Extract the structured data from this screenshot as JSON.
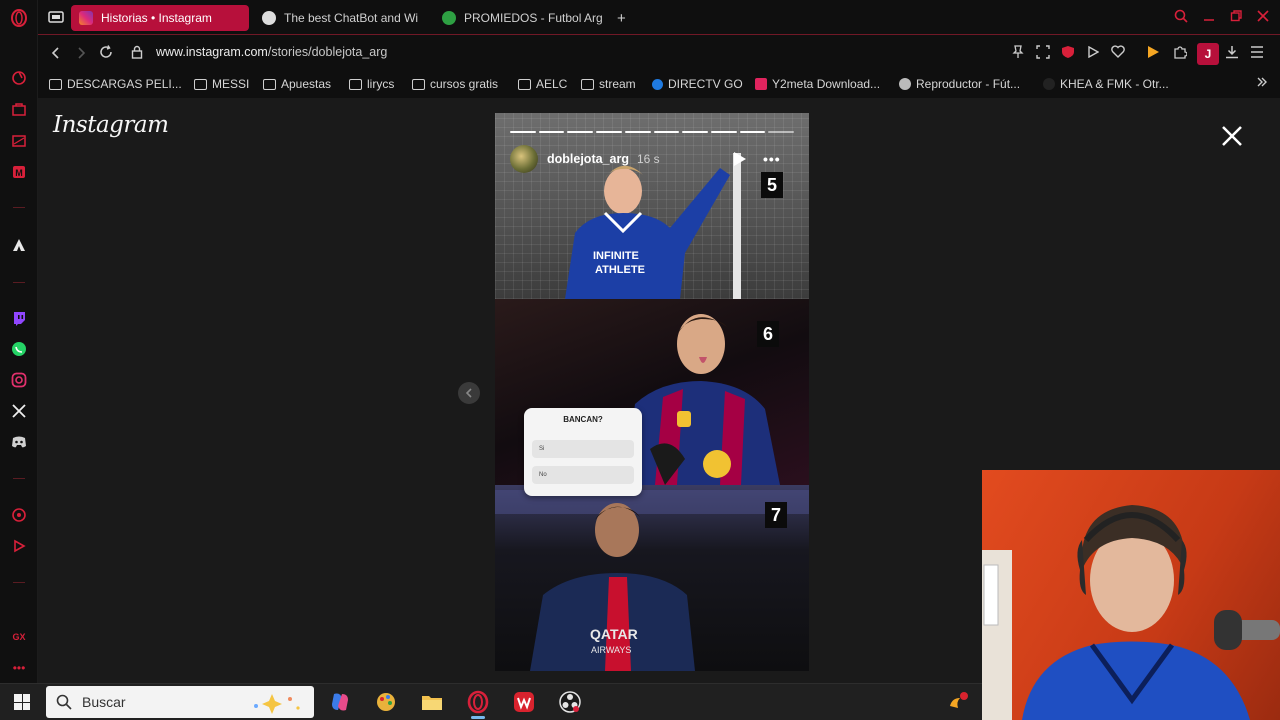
{
  "colors": {
    "accent": "#b7103b",
    "opera_red": "#d8203a",
    "page_bg": "#1a1a1a",
    "taskbar_bg": "#202020"
  },
  "sidebar": {
    "icons": [
      "opera-logo-icon",
      "aria-icon",
      "workspaces-icon",
      "wallet-icon",
      "messenger-icon",
      "vk-icon",
      "twitch-icon",
      "whatsapp-icon",
      "instagram-icon",
      "x-icon",
      "discord-icon",
      "player-icon",
      "music-icon",
      "gx-label",
      "more-icon"
    ],
    "gx_label": "GX"
  },
  "tabs": [
    {
      "title": "Historias • Instagram",
      "active": true,
      "favicon_color": "#e1306c",
      "favicon": "instagram-favicon-icon"
    },
    {
      "title": "The best ChatBot and Wi",
      "active": false,
      "favicon_color": "#dddddd",
      "favicon": "chatbot-favicon-icon"
    },
    {
      "title": "PROMIEDOS - Futbol Arg",
      "active": false,
      "favicon_color": "#2ea043",
      "favicon": "promiedos-favicon-icon"
    }
  ],
  "new_tab_label": "+",
  "address": {
    "host": "www.instagram.com",
    "path": "/stories/doblejota_arg"
  },
  "profile_initial": "J",
  "bookmarks": [
    {
      "label": "DESCARGAS PELI...",
      "type": "folder"
    },
    {
      "label": "MESSI",
      "type": "folder"
    },
    {
      "label": "Apuestas",
      "type": "folder"
    },
    {
      "label": "lirycs",
      "type": "folder"
    },
    {
      "label": "cursos gratis",
      "type": "folder"
    },
    {
      "label": "AELC",
      "type": "folder"
    },
    {
      "label": "stream",
      "type": "folder"
    },
    {
      "label": "DIRECTV GO",
      "type": "site",
      "color": "#1f7ae0"
    },
    {
      "label": "Y2meta Download...",
      "type": "site",
      "color": "#e0245e"
    },
    {
      "label": "Reproductor - Fút...",
      "type": "site",
      "color": "#bbbbbb"
    },
    {
      "label": "KHEA & FMK - Otr...",
      "type": "site",
      "color": "#222222"
    }
  ],
  "page": {
    "logo": "Instagram",
    "story": {
      "username": "doblejota_arg",
      "time": "16 s",
      "segments_total": 10,
      "segments_done": 9,
      "more_label": "•••",
      "badges": [
        "5",
        "6",
        "7"
      ],
      "poll": {
        "question": "BANCAN?",
        "options": [
          "Si",
          "No"
        ]
      }
    }
  },
  "taskbar": {
    "search_placeholder": "Buscar",
    "apps": [
      {
        "name": "copilot-icon",
        "color": "#3b7be8"
      },
      {
        "name": "paint-icon",
        "color": "#e9b23b"
      },
      {
        "name": "file-explorer-icon",
        "color": "#f2c14e"
      },
      {
        "name": "opera-gx-icon",
        "color": "#d8203a"
      },
      {
        "name": "wps-office-icon",
        "color": "#d9232e"
      },
      {
        "name": "obs-icon",
        "color": "#e5e5e5"
      }
    ]
  }
}
